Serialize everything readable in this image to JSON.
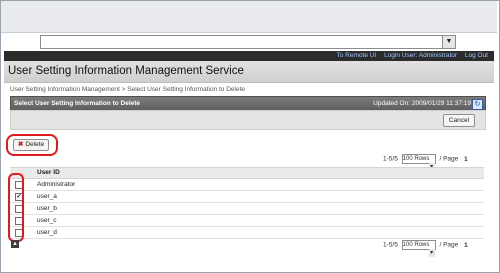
{
  "browser": {
    "address_value": ""
  },
  "topbar": {
    "remote_ui_link": "To Remote UI",
    "login_user": "Login User: Administrator",
    "logout_link": "Log Out"
  },
  "page": {
    "title": "User Setting Information Management Service",
    "breadcrumb": "User Setting Information Management > Select User Setting Information to Delete"
  },
  "panel": {
    "header_left": "Select User Setting Information to Delete",
    "updated_on": "Updated On: 2009/01/29 11:37:19",
    "cancel_label": "Cancel"
  },
  "actions": {
    "delete_label": "Delete",
    "delete_icon": "x-icon"
  },
  "pager": {
    "range": "1-5/5",
    "rows_selected": "100 Rows",
    "page_label": "/ Page",
    "page_number": "1"
  },
  "table": {
    "header": "User ID",
    "rows": [
      {
        "user_id": "Administrator",
        "checked": false
      },
      {
        "user_id": "user_a",
        "checked": true
      },
      {
        "user_id": "user_b",
        "checked": false
      },
      {
        "user_id": "user_c",
        "checked": false
      },
      {
        "user_id": "user_d",
        "checked": false
      }
    ]
  },
  "colors": {
    "highlight": "#e11b1b",
    "topbar_bg": "#2b2b2b"
  }
}
